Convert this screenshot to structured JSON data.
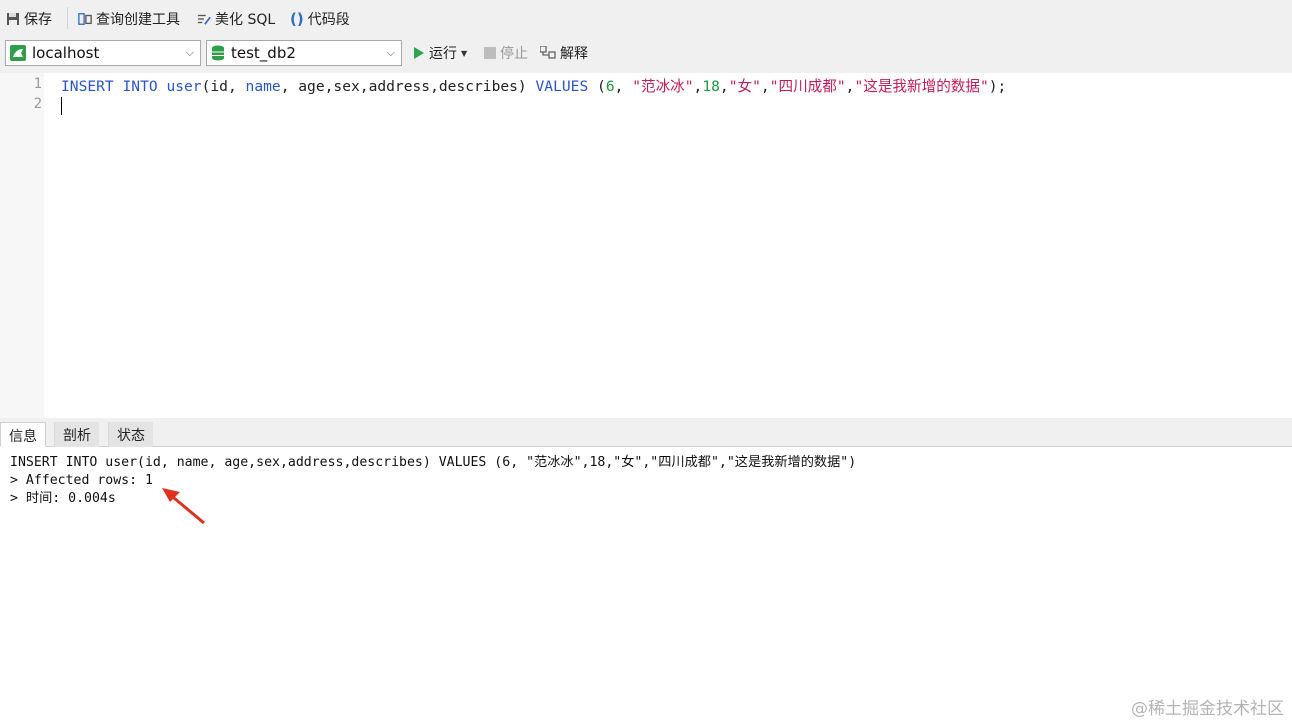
{
  "toolbar": {
    "save_label": "保存",
    "query_builder_label": "查询创建工具",
    "beautify_label": "美化 SQL",
    "snippet_label": "代码段",
    "run_label": "运行",
    "stop_label": "停止",
    "explain_label": "解释"
  },
  "connection": {
    "selected": "localhost"
  },
  "database": {
    "selected": "test_db2"
  },
  "editor": {
    "line_numbers": [
      "1",
      "2"
    ],
    "line1": {
      "kw_insert": "INSERT INTO",
      "kw_user": "user",
      "cols_open": "(id, ",
      "kw_name": "name",
      "cols_rest": ", age,sex,address,describes) ",
      "kw_values": "VALUES",
      "paren": " (",
      "val_id": "6",
      "comma1": ", ",
      "val_name": "\"范冰冰\"",
      "comma2": ",",
      "val_age": "18",
      "comma3": ",",
      "val_sex": "\"女\"",
      "comma4": ",",
      "val_address": "\"四川成都\"",
      "comma5": ",",
      "val_desc": "\"这是我新增的数据\"",
      "end": ");"
    }
  },
  "result_tabs": [
    "信息",
    "剖析",
    "状态"
  ],
  "output": {
    "line1": "INSERT INTO user(id, name, age,sex,address,describes) VALUES (6, \"范冰冰\",18,\"女\",\"四川成都\",\"这是我新增的数据\")",
    "line2": "> Affected rows: 1",
    "line3": "> 时间: 0.004s"
  },
  "watermark": "@稀土掘金技术社区",
  "colors": {
    "keyword": "#2a55c9",
    "number": "#1c9a3c",
    "string": "#c41c5a",
    "arrow": "#e0301e"
  }
}
